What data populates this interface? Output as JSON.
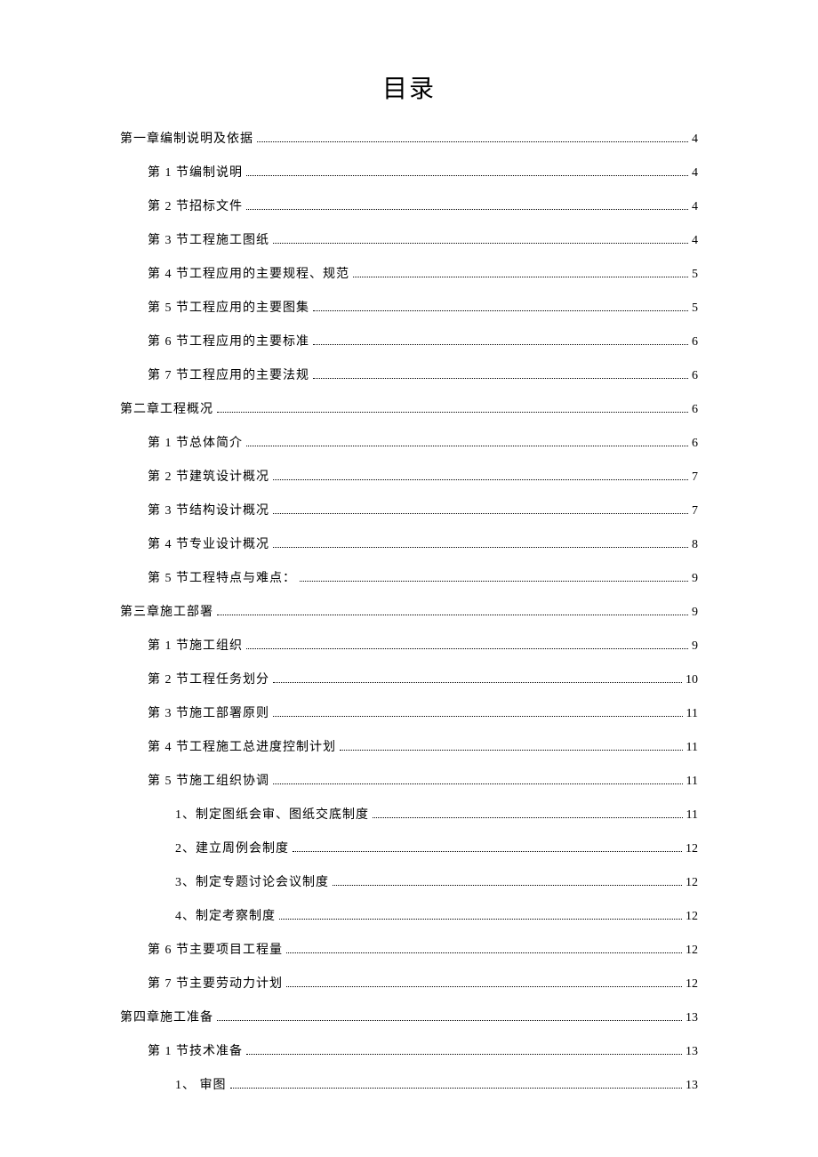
{
  "title": "目录",
  "toc": [
    {
      "level": 0,
      "label": "第一章编制说明及依据",
      "page": "4"
    },
    {
      "level": 1,
      "label": "第 1 节编制说明",
      "page": "4"
    },
    {
      "level": 1,
      "label": "第 2 节招标文件",
      "page": "4"
    },
    {
      "level": 1,
      "label": "第 3 节工程施工图纸",
      "page": "4"
    },
    {
      "level": 1,
      "label": "第 4 节工程应用的主要规程、规范",
      "page": "5"
    },
    {
      "level": 1,
      "label": "第 5 节工程应用的主要图集",
      "page": "5"
    },
    {
      "level": 1,
      "label": "第 6 节工程应用的主要标准",
      "page": "6"
    },
    {
      "level": 1,
      "label": "第 7 节工程应用的主要法规",
      "page": "6"
    },
    {
      "level": 0,
      "label": "第二章工程概况",
      "page": "6"
    },
    {
      "level": 1,
      "label": "第 1 节总体简介",
      "page": "6"
    },
    {
      "level": 1,
      "label": "第 2 节建筑设计概况",
      "page": "7"
    },
    {
      "level": 1,
      "label": "第 3 节结构设计概况",
      "page": "7"
    },
    {
      "level": 1,
      "label": "第 4 节专业设计概况",
      "page": "8"
    },
    {
      "level": 1,
      "label": "第 5 节工程特点与难点：",
      "page": "9"
    },
    {
      "level": 0,
      "label": "第三章施工部署",
      "page": "9"
    },
    {
      "level": 1,
      "label": "第 1 节施工组织",
      "page": "9"
    },
    {
      "level": 1,
      "label": "第 2 节工程任务划分",
      "page": "10"
    },
    {
      "level": 1,
      "label": "第 3 节施工部署原则",
      "page": "11"
    },
    {
      "level": 1,
      "label": "第 4 节工程施工总进度控制计划",
      "page": "11"
    },
    {
      "level": 1,
      "label": "第 5 节施工组织协调",
      "page": "11"
    },
    {
      "level": 2,
      "label": "1、制定图纸会审、图纸交底制度",
      "page": "11"
    },
    {
      "level": 2,
      "label": "2、建立周例会制度",
      "page": "12"
    },
    {
      "level": 2,
      "label": "3、制定专题讨论会议制度",
      "page": "12"
    },
    {
      "level": 2,
      "label": "4、制定考察制度",
      "page": "12"
    },
    {
      "level": 1,
      "label": "第 6 节主要项目工程量",
      "page": "12"
    },
    {
      "level": 1,
      "label": "第 7 节主要劳动力计划",
      "page": "12"
    },
    {
      "level": 0,
      "label": "第四章施工准备",
      "page": "13"
    },
    {
      "level": 1,
      "label": "第 1 节技术准备",
      "page": "13"
    },
    {
      "level": 2,
      "label": "1、 审图",
      "page": "13"
    }
  ]
}
